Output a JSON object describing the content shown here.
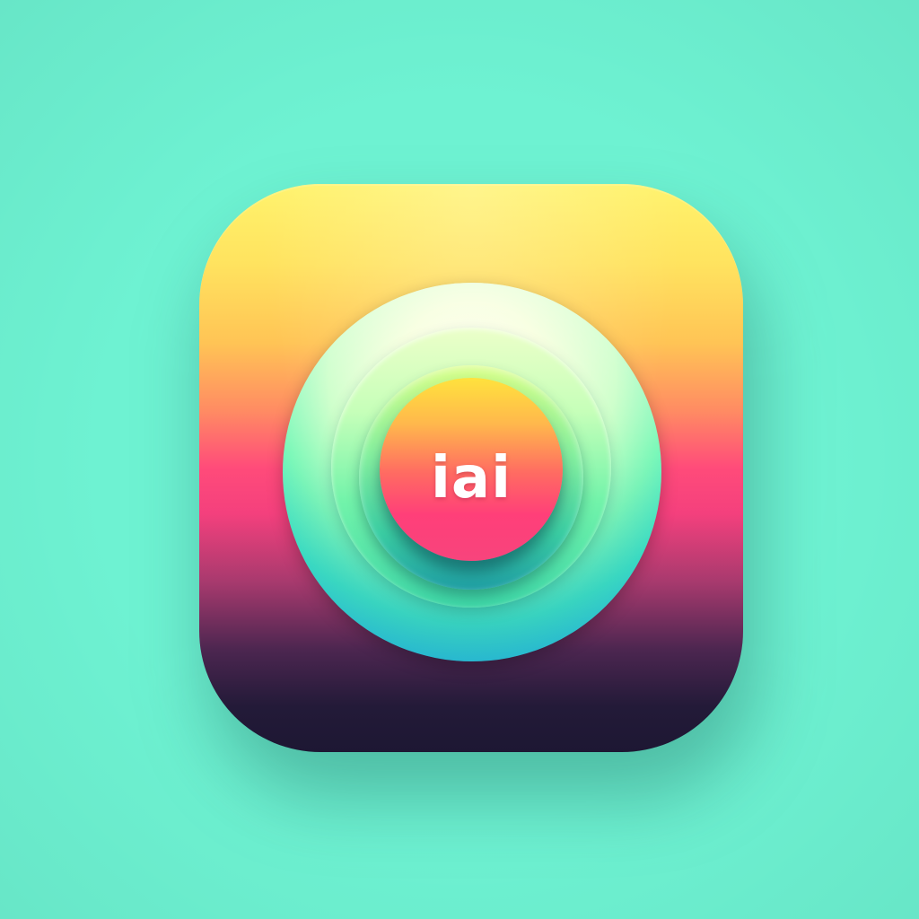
{
  "background": {
    "color": "#6ef2d2"
  },
  "app_icon": {
    "label": "iai",
    "icon": "concentric-circles-app-icon",
    "colors": {
      "top": "#fff36c",
      "middle": "#ff4b7a",
      "bottom": "#1d1733",
      "ring": "#72f3aa",
      "core": "#ff3f79",
      "text": "#ffffff"
    }
  }
}
